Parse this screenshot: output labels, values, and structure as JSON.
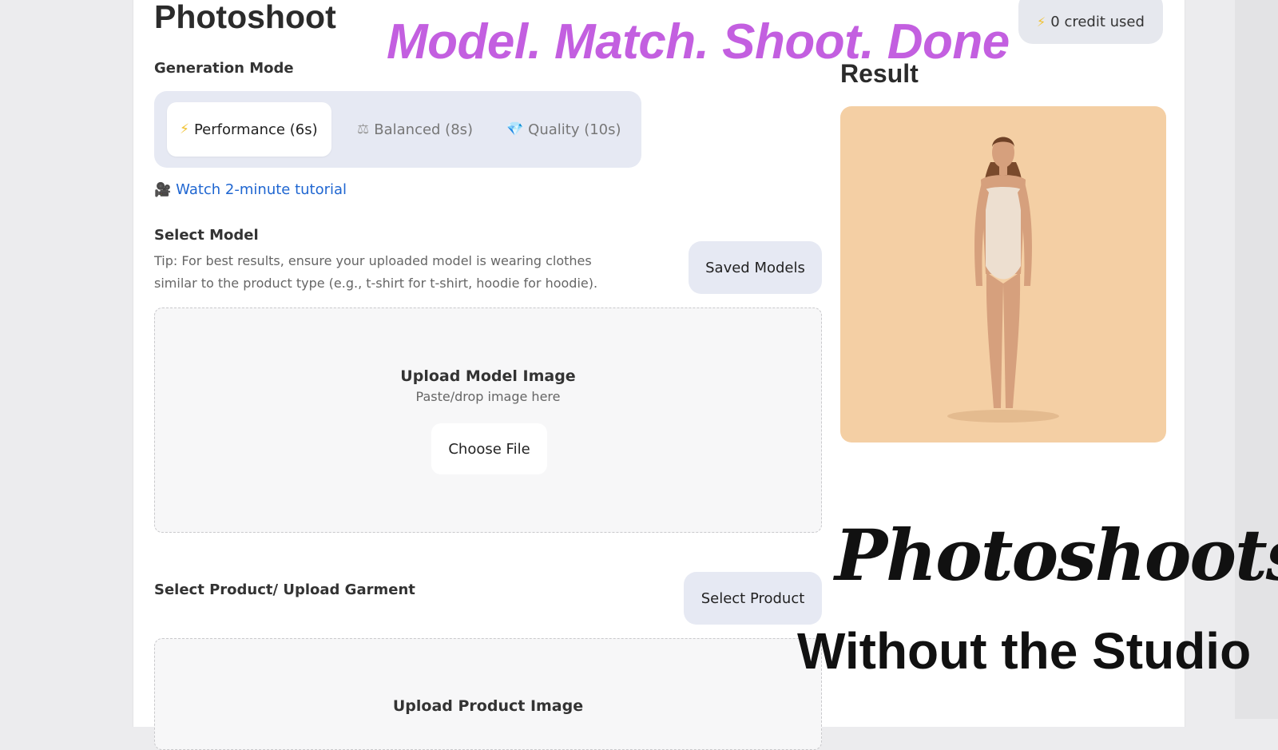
{
  "page": {
    "title": "Photoshoot",
    "tagline": "Model. Match. Shoot. Done",
    "credit_badge": "0 credit used",
    "credit_icon": "lightning-icon"
  },
  "generation": {
    "label": "Generation Mode",
    "modes": [
      {
        "icon": "⚡",
        "icon_name": "lightning-icon",
        "label": "Performance (6s)",
        "active": true
      },
      {
        "icon": "⚖",
        "icon_name": "scale-icon",
        "label": "Balanced (8s)",
        "active": false
      },
      {
        "icon": "💎",
        "icon_name": "gem-icon",
        "label": "Quality (10s)",
        "active": false
      }
    ]
  },
  "tutorial": {
    "icon_name": "video-camera-icon",
    "link_text": "Watch 2-minute tutorial"
  },
  "model_section": {
    "label": "Select Model",
    "tip": "Tip: For best results, ensure your uploaded model is wearing clothes similar to the product type (e.g., t-shirt for t-shirt, hoodie for hoodie).",
    "saved_button": "Saved Models",
    "upload_title": "Upload Model Image",
    "upload_sub": "Paste/drop image here",
    "choose_file": "Choose File"
  },
  "product_section": {
    "label": "Select Product/ Upload Garment",
    "select_button": "Select Product",
    "upload_title": "Upload Product Image"
  },
  "result": {
    "title": "Result",
    "background_color": "#f4cfa4"
  },
  "promo": {
    "headline": "Photoshoots",
    "subline": "Without the Studio"
  },
  "colors": {
    "accent": "#c35fe0",
    "link": "#1f66d1",
    "pill_bg": "#e6e9f3"
  }
}
